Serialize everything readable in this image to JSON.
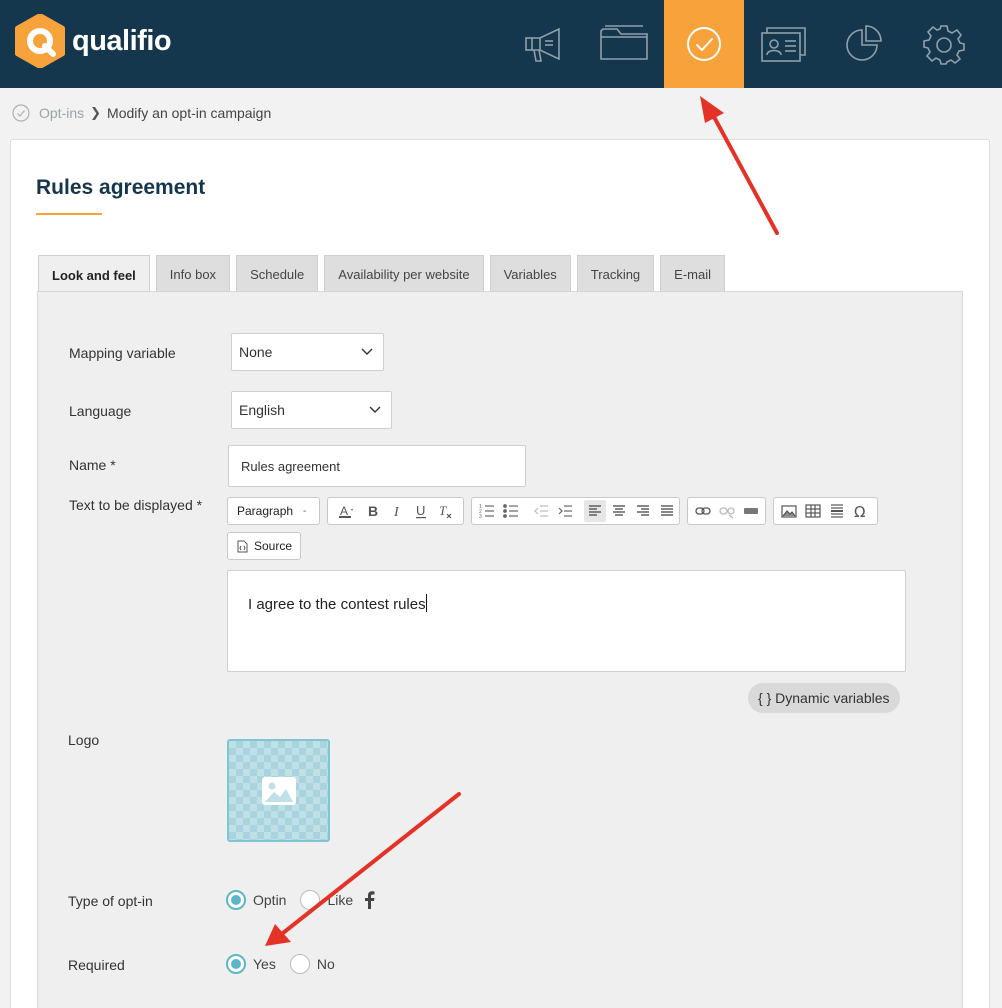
{
  "brand": {
    "name": "qualifio",
    "accent": "#f7a23a",
    "navy": "#15374d"
  },
  "nav": {
    "items": [
      {
        "icon": "megaphone-icon",
        "active": false
      },
      {
        "icon": "folder-icon",
        "active": false
      },
      {
        "icon": "check-circle-icon",
        "active": true
      },
      {
        "icon": "contact-cards-icon",
        "active": false
      },
      {
        "icon": "pie-chart-icon",
        "active": false
      },
      {
        "icon": "gear-icon",
        "active": false
      }
    ]
  },
  "breadcrumb": {
    "parent": "Opt-ins",
    "current": "Modify an opt-in campaign"
  },
  "page": {
    "title": "Rules agreement"
  },
  "tabs": [
    "Look and feel",
    "Info box",
    "Schedule",
    "Availability per website",
    "Variables",
    "Tracking",
    "E-mail"
  ],
  "form": {
    "mapping_variable": {
      "label": "Mapping variable",
      "value": "None"
    },
    "language": {
      "label": "Language",
      "value": "English"
    },
    "name": {
      "label": "Name *",
      "value": "Rules agreement"
    },
    "text": {
      "label": "Text to be displayed *",
      "paragraph": "Paragraph",
      "source": "Source",
      "content": "I agree to the contest rules",
      "dynamic_variables": "{ } Dynamic variables"
    },
    "logo": {
      "label": "Logo"
    },
    "optin_type": {
      "label": "Type of opt-in",
      "options": [
        "Optin",
        "Like"
      ],
      "selected": "Optin"
    },
    "required": {
      "label": "Required",
      "options": [
        "Yes",
        "No"
      ],
      "selected": "Yes"
    }
  }
}
